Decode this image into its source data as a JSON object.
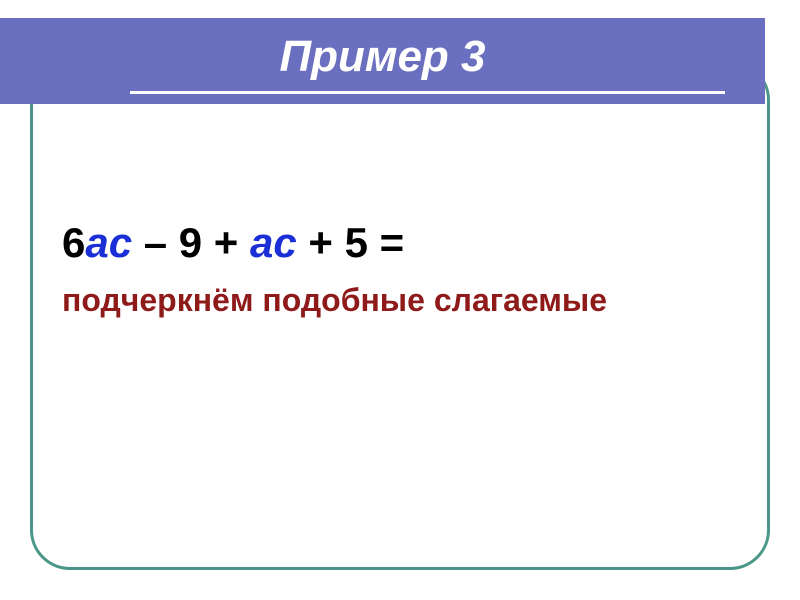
{
  "title": "Пример 3",
  "equation": {
    "coef1": "6",
    "var1": "ас",
    "op1": " – 9 + ",
    "var2": "ас",
    "op2": " + 5 ="
  },
  "subtitle": "подчеркнём подобные слагаемые"
}
